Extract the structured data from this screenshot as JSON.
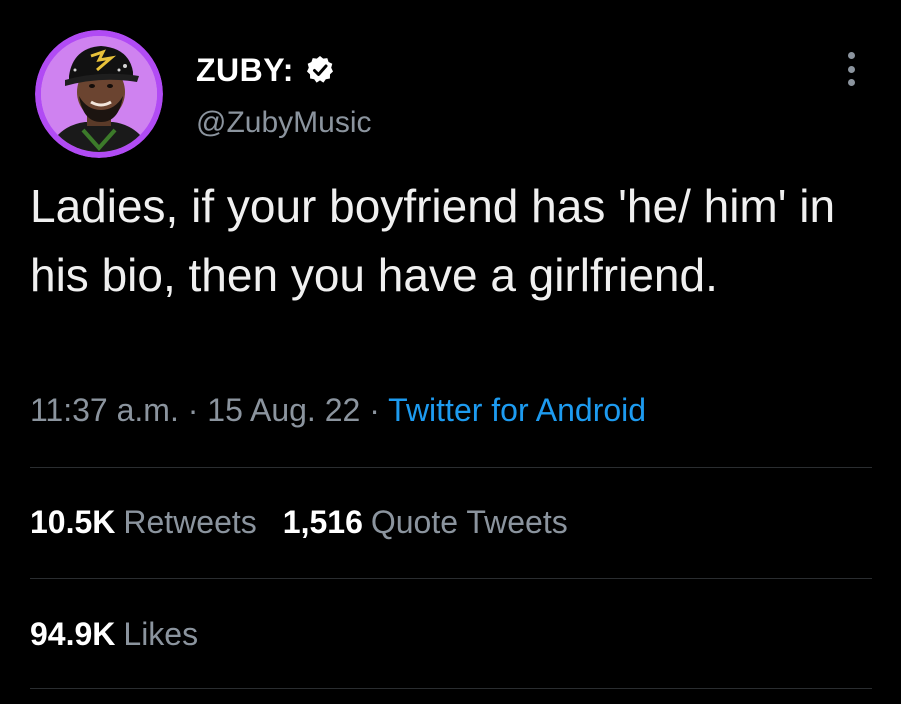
{
  "author": {
    "display_name": "ZUBY:",
    "handle": "@ZubyMusic",
    "verified": true,
    "avatar_ring_color": "#b14bf4"
  },
  "tweet": {
    "text": "Ladies, if your boyfriend has 'he/ him' in his bio, then you have a girlfriend.",
    "time": "11:37 a.m.",
    "separator": "·",
    "date": "15 Aug. 22",
    "source": "Twitter for Android"
  },
  "stats": {
    "retweets_count": "10.5K",
    "retweets_label": "Retweets",
    "quotes_count": "1,516",
    "quotes_label": "Quote Tweets",
    "likes_count": "94.9K",
    "likes_label": "Likes"
  },
  "icons": {
    "verified": "verified-badge-icon",
    "more": "more-options-icon"
  },
  "colors": {
    "background": "#000000",
    "link": "#1d9bf0",
    "secondary_text": "#8b949e",
    "primary_text": "#ffffff"
  }
}
